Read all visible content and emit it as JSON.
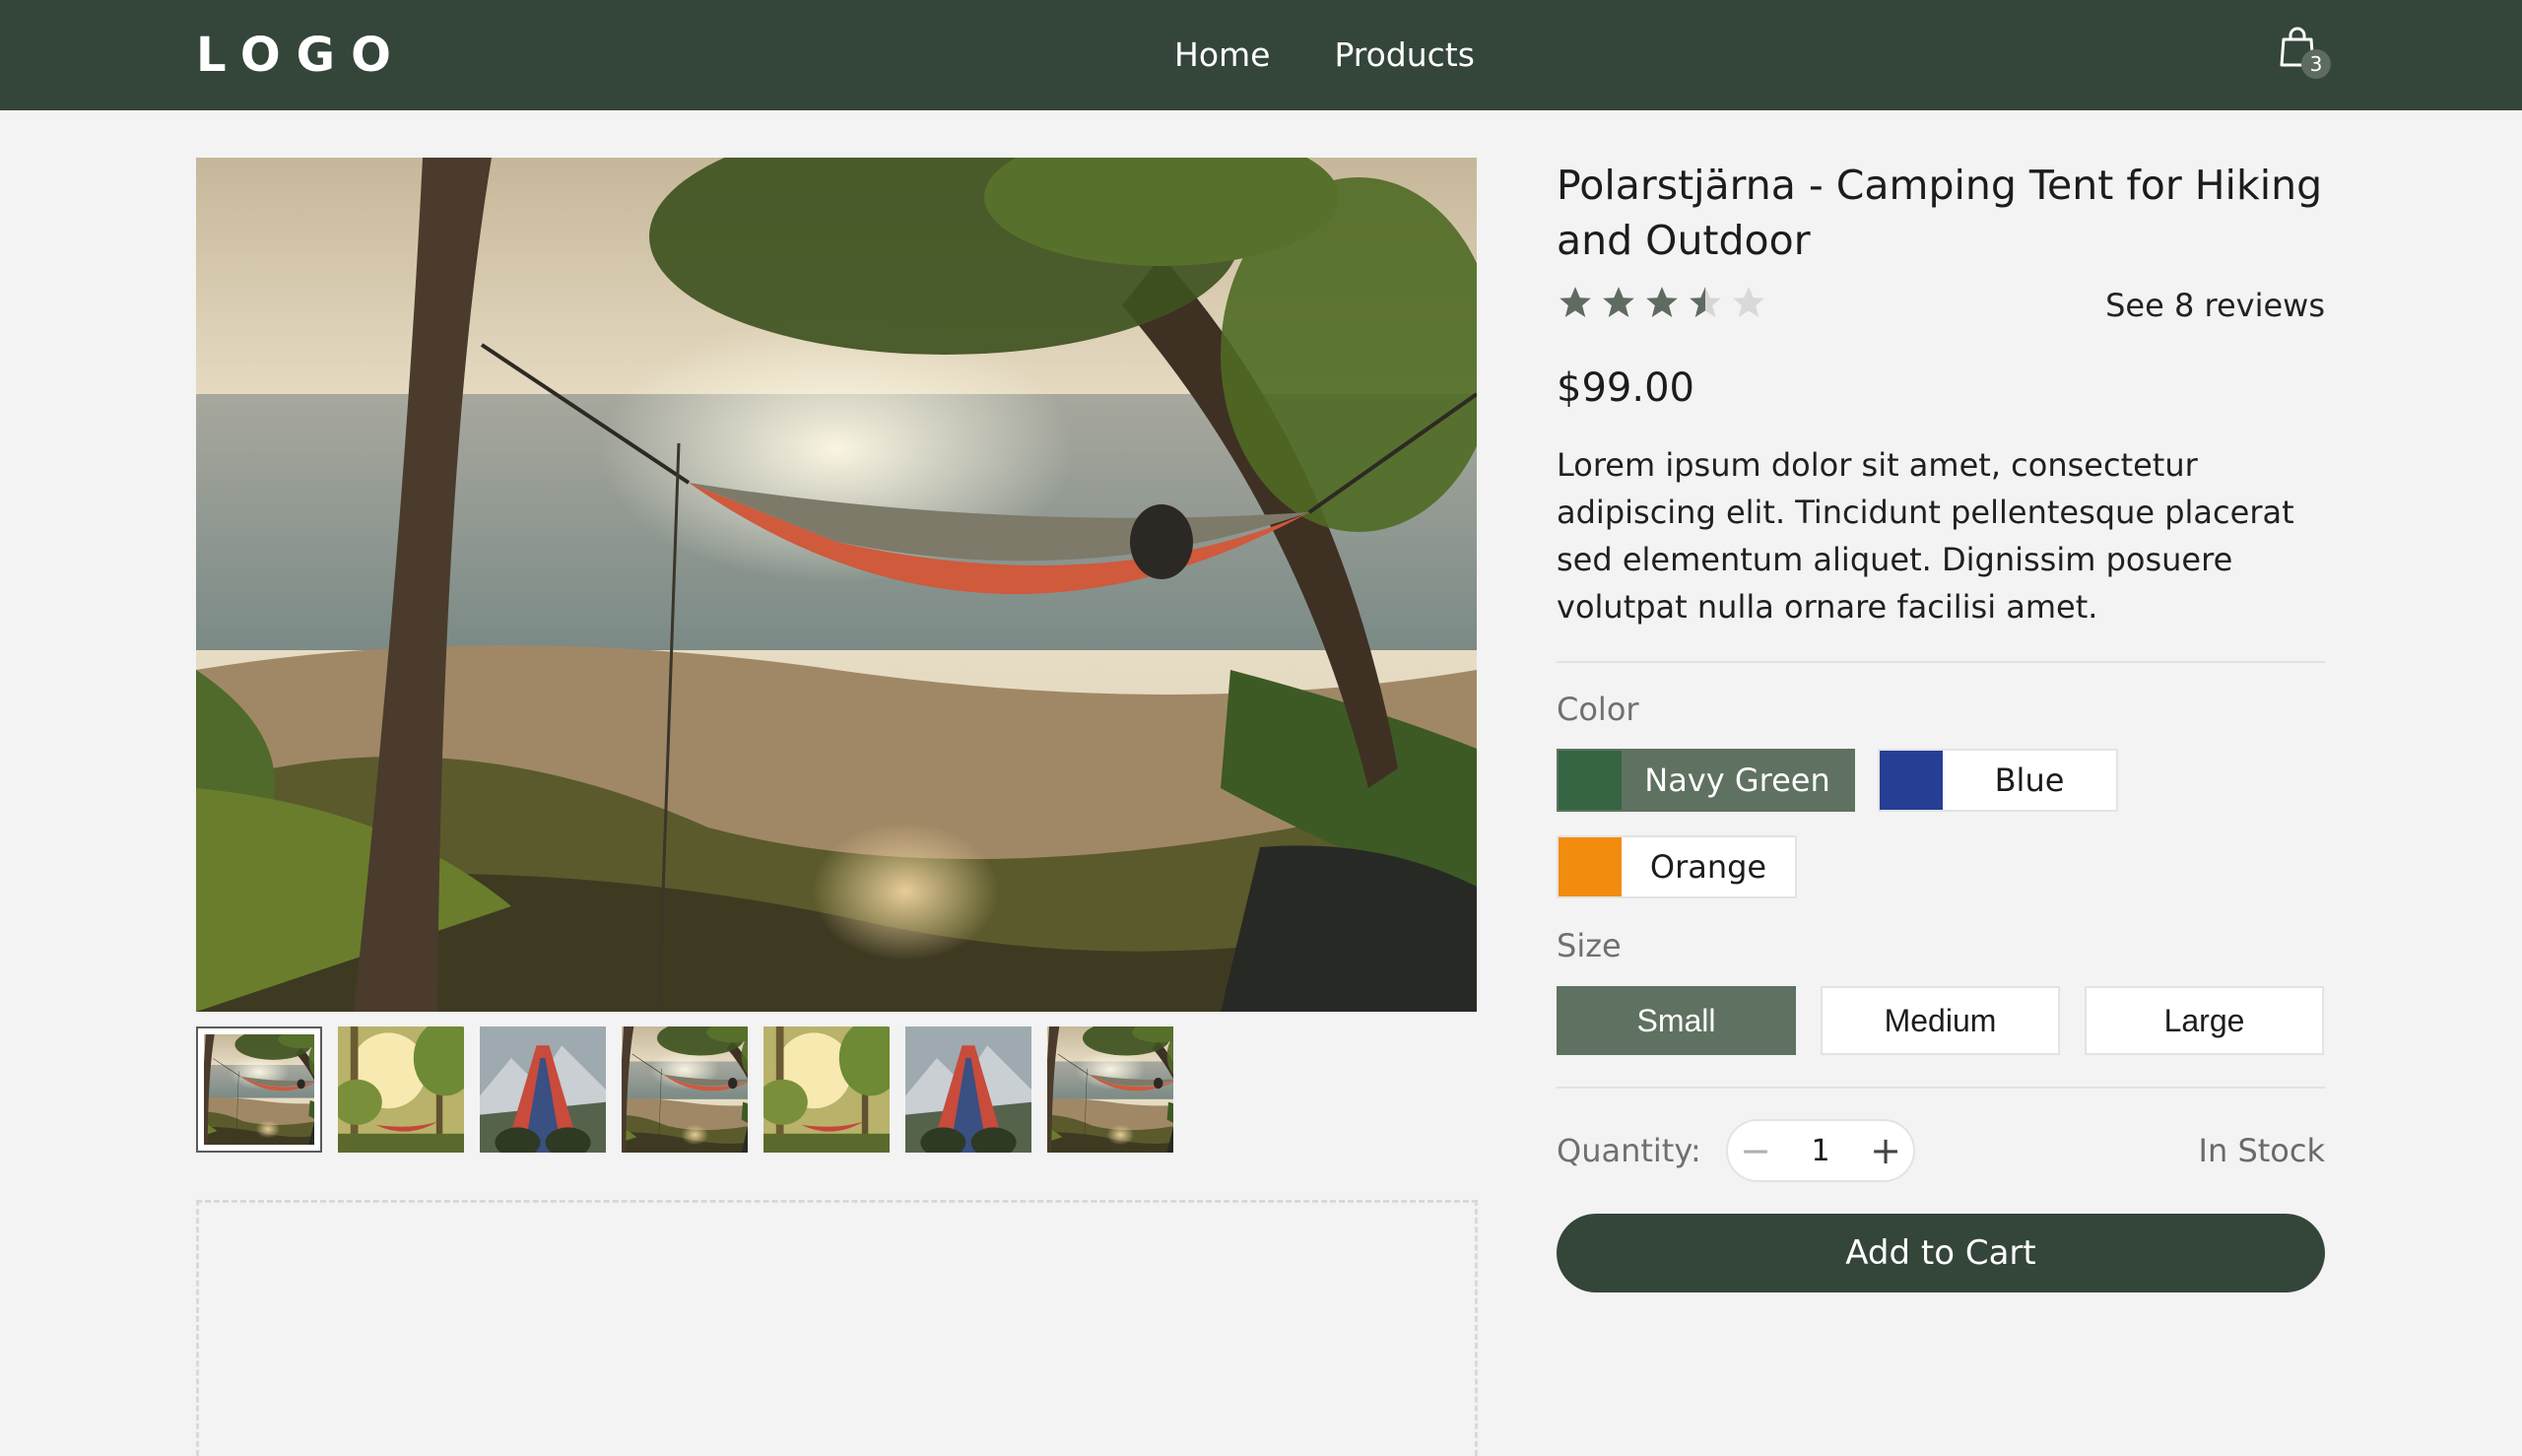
{
  "header": {
    "logo": "LOGO",
    "nav": [
      {
        "label": "Home"
      },
      {
        "label": "Products"
      }
    ],
    "cart_count": "3",
    "cart_icon": "shopping-bag-icon",
    "background": "#34453a"
  },
  "gallery": {
    "main_image": "hammock-by-the-sea-photo",
    "thumbnails": [
      {
        "name": "hammock-beach",
        "selected": true
      },
      {
        "name": "hammock-forest-sunlight",
        "selected": false
      },
      {
        "name": "feet-in-hammock-mountains",
        "selected": false
      },
      {
        "name": "hammock-beach",
        "selected": false
      },
      {
        "name": "hammock-forest-sunlight",
        "selected": false
      },
      {
        "name": "feet-in-hammock-mountains",
        "selected": false
      },
      {
        "name": "hammock-beach",
        "selected": false
      }
    ]
  },
  "product": {
    "title": "Polarstjärna - Camping Tent for Hiking and Outdoor",
    "rating": 3.5,
    "rating_max": 5,
    "reviews_link": "See 8 reviews",
    "price": "$99.00",
    "description": "Lorem ipsum dolor sit amet, consectetur adipiscing elit. Tincidunt pellentesque placerat sed elementum aliquet. Dignissim posuere volutpat nulla ornare facilisi amet.",
    "color_label": "Color",
    "colors": [
      {
        "name": "Navy Green",
        "hex": "#356543",
        "selected": true
      },
      {
        "name": "Blue",
        "hex": "#263f94",
        "selected": false
      },
      {
        "name": "Orange",
        "hex": "#f28c0f",
        "selected": false
      }
    ],
    "size_label": "Size",
    "sizes": [
      {
        "name": "Small",
        "selected": true
      },
      {
        "name": "Medium",
        "selected": false
      },
      {
        "name": "Large",
        "selected": false
      }
    ],
    "quantity_label": "Quantity:",
    "quantity": "1",
    "stock": "In Stock",
    "add_to_cart": "Add to Cart"
  },
  "colors": {
    "brand_dark": "#34453a",
    "selected_option": "#5f7160",
    "star": "#5f6b61"
  }
}
